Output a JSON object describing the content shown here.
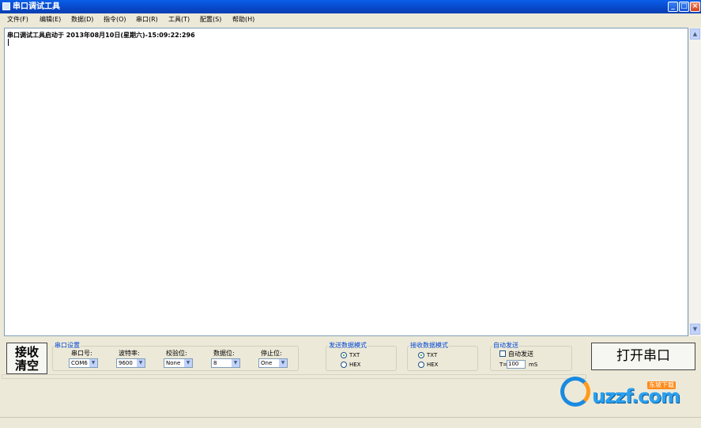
{
  "window": {
    "title": "串口调试工具"
  },
  "menu": [
    {
      "label": "文件(F)"
    },
    {
      "label": "编辑(E)"
    },
    {
      "label": "数据(D)"
    },
    {
      "label": "指令(O)"
    },
    {
      "label": "串口(R)"
    },
    {
      "label": "工具(T)"
    },
    {
      "label": "配置(S)"
    },
    {
      "label": "帮助(H)"
    }
  ],
  "log": {
    "first_line": "串口调试工具启动于 2013年08月10日(星期六)-15:09:22:296"
  },
  "controls": {
    "clear_button_line1": "接收",
    "clear_button_line2": "清空",
    "open_button": "打开串口"
  },
  "serial_settings": {
    "group_label": "串口设置",
    "port": {
      "label": "串口号:",
      "value": "COM6"
    },
    "baud": {
      "label": "波特率:",
      "value": "9600"
    },
    "parity": {
      "label": "校验位:",
      "value": "None"
    },
    "databits": {
      "label": "数据位:",
      "value": "8"
    },
    "stopbits": {
      "label": "停止位:",
      "value": "One"
    }
  },
  "send_mode": {
    "group_label": "发送数据模式",
    "options": [
      "TXT",
      "HEX"
    ],
    "selected": "TXT"
  },
  "recv_mode": {
    "group_label": "接收数据模式",
    "options": [
      "TXT",
      "HEX"
    ],
    "selected": "TXT"
  },
  "auto_send": {
    "group_label": "自动发送",
    "checkbox_label": "自动发送",
    "checked": false,
    "interval_prefix": "T=",
    "interval_value": "100",
    "unit": "mS"
  },
  "watermark": {
    "text": "uzzf.com",
    "badge": "东坡下载"
  }
}
